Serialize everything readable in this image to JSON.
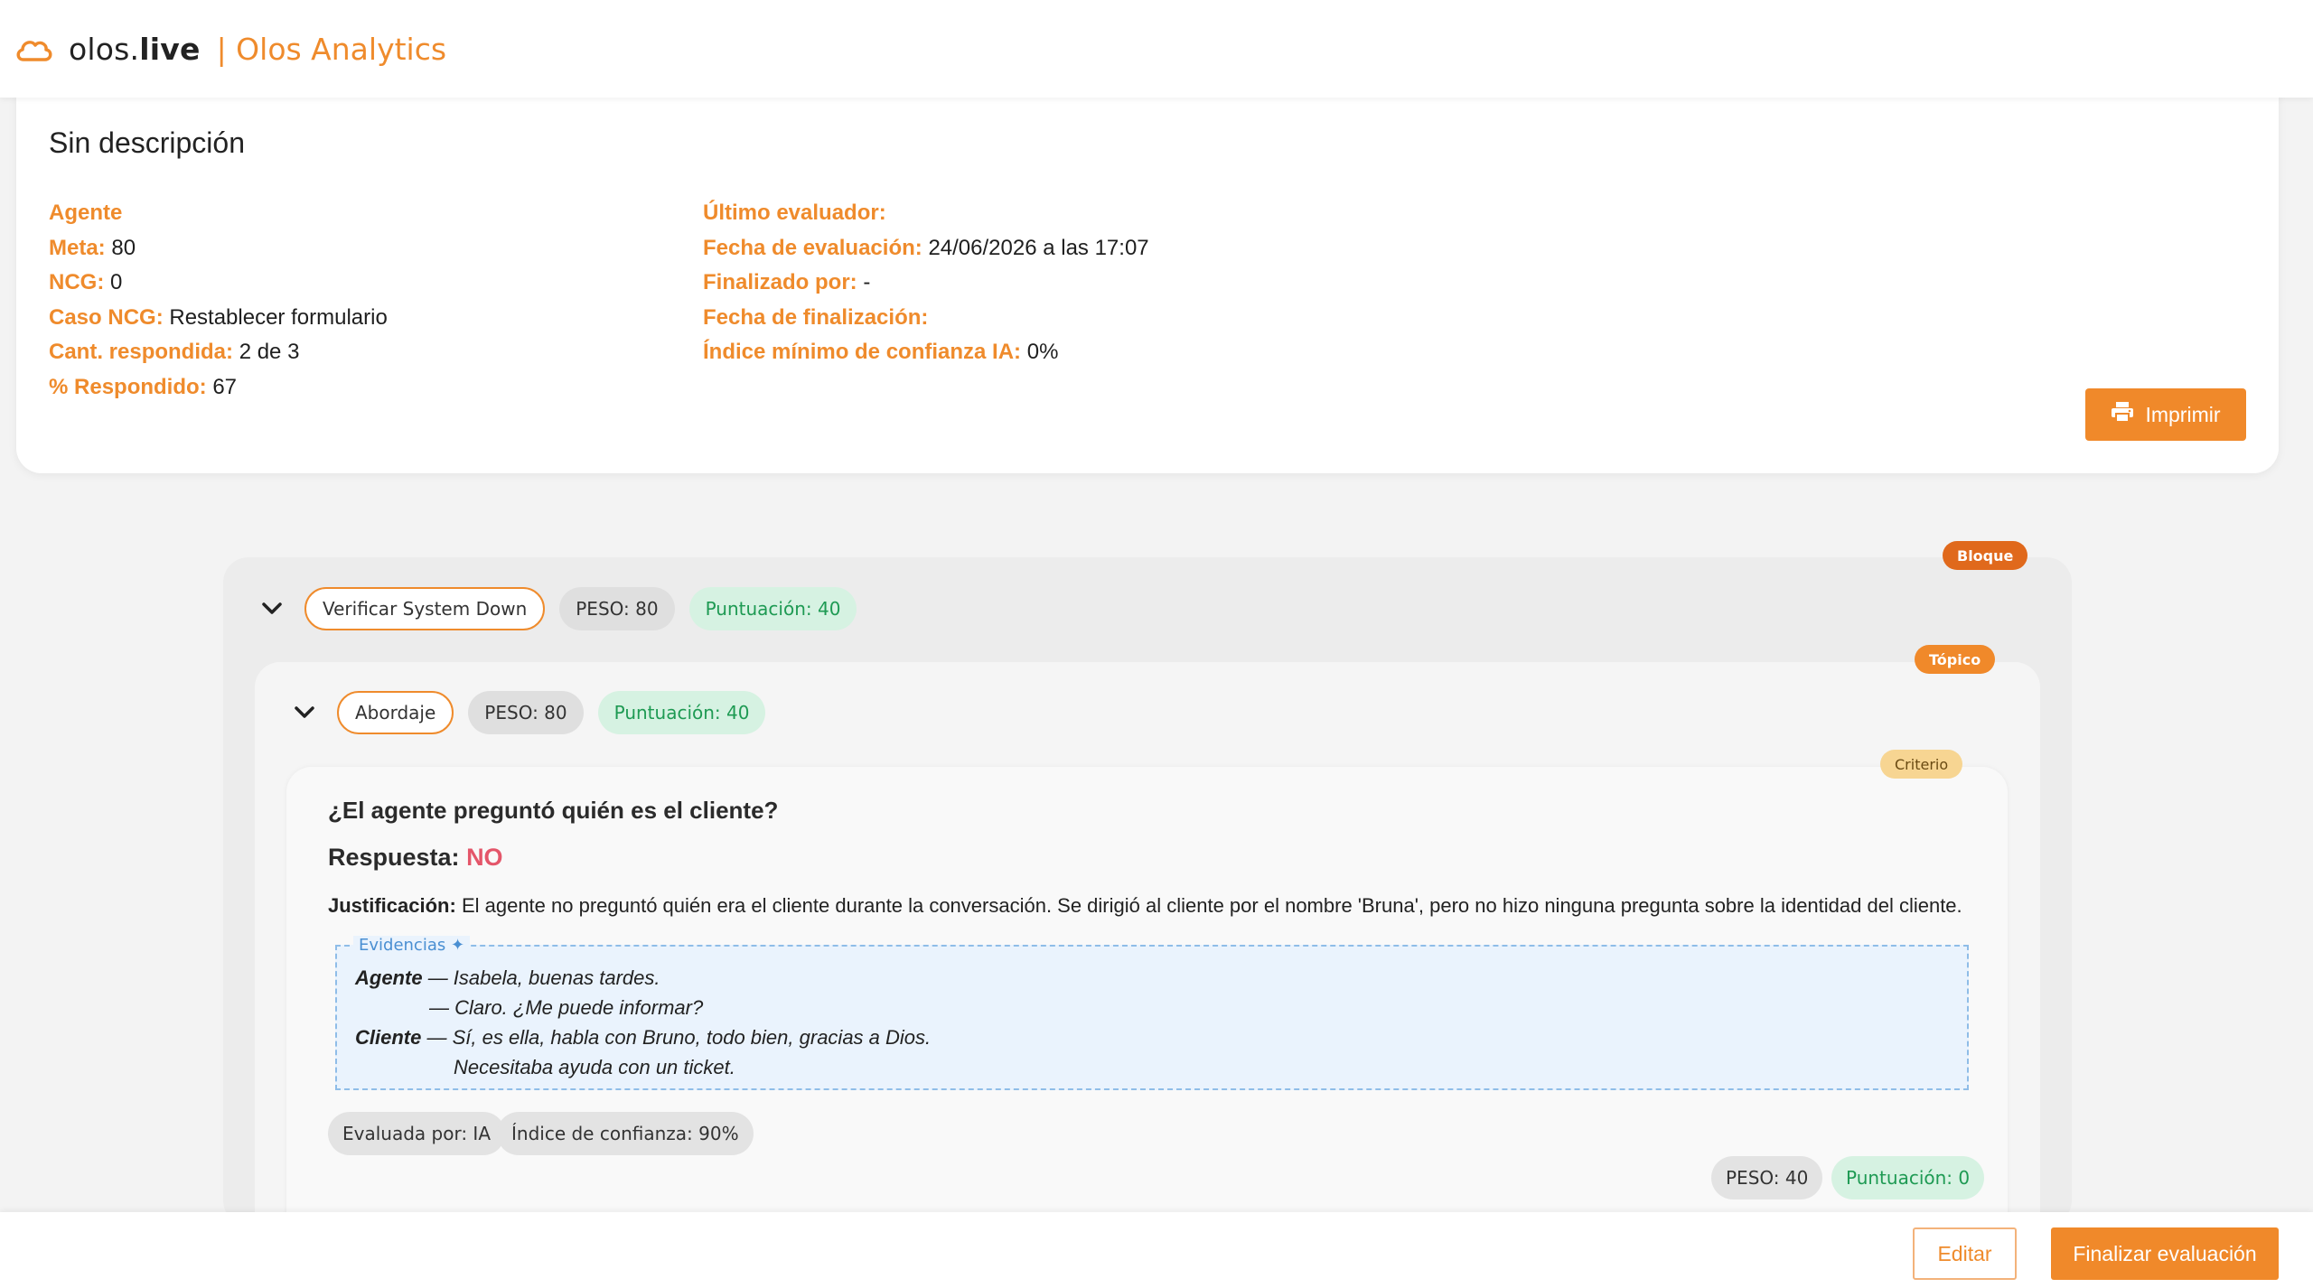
{
  "header": {
    "brand_prefix": "olos.",
    "brand_bold": "live",
    "product": "| Olos Analytics"
  },
  "summary": {
    "title": "Sin descripción",
    "left": [
      {
        "label": "Agente",
        "value": ""
      },
      {
        "label": "Meta:",
        "value": "80"
      },
      {
        "label": "NCG:",
        "value": "0"
      },
      {
        "label": "Caso NCG:",
        "value": "Restablecer formulario"
      },
      {
        "label": "Cant. respondida:",
        "value": "2 de 3"
      },
      {
        "label": "% Respondido:",
        "value": "67"
      }
    ],
    "right": [
      {
        "label": "Último evaluador:",
        "value": ""
      },
      {
        "label": "Fecha de evaluación:",
        "value": "24/06/2026 a las 17:07"
      },
      {
        "label": "Finalizado por:",
        "value": "-"
      },
      {
        "label": "Fecha de finalización:",
        "value": ""
      },
      {
        "label": "Índice mínimo de confianza IA:",
        "value": "0%"
      }
    ],
    "print_label": "Imprimir"
  },
  "block": {
    "tag": "Bloque",
    "name": "Verificar System Down",
    "peso": "PESO: 80",
    "score": "Puntuación: 40"
  },
  "topic": {
    "tag": "Tópico",
    "name": "Abordaje",
    "peso": "PESO: 80",
    "score": "Puntuación: 40"
  },
  "criterion": {
    "tag": "Criterio",
    "question": "¿El agente preguntó quién es el cliente?",
    "answer_label": "Respuesta:",
    "answer_value": "NO",
    "justification_label": "Justificación:",
    "justification": "El agente no preguntó quién era el cliente durante la conversación. Se dirigió al cliente por el nombre 'Bruna', pero no hizo ninguna pregunta sobre la identidad del cliente.",
    "evidence_label": "Evidencias ✦",
    "evidence": [
      {
        "speaker": "Agente",
        "text": "— Isabela, buenas tardes."
      },
      {
        "speaker": "",
        "text": "— Claro. ¿Me puede informar?"
      },
      {
        "speaker": "Cliente",
        "text": "— Sí, es ella, habla con Bruno, todo bien, gracias a Dios."
      },
      {
        "speaker": "",
        "text": "Necesitaba ayuda con un ticket."
      }
    ],
    "evaluated_by": "Evaluada por: IA",
    "confidence": "Índice de confianza: 90%",
    "peso": "PESO: 40",
    "score": "Puntuación: 0"
  },
  "footer": {
    "edit_label": "Editar",
    "finish_label": "Finalizar evaluación"
  },
  "colors": {
    "accent": "#ef8b2c",
    "block_tag": "#e0691c",
    "score_green": "#1e9a53",
    "answer_no": "#e4566a"
  }
}
